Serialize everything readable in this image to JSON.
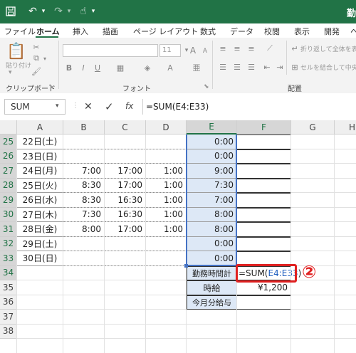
{
  "title_bar": {
    "right_text": "勤",
    "undo_icon": "undo-icon",
    "redo_icon": "redo-icon"
  },
  "tabs": [
    "ファイル",
    "ホーム",
    "挿入",
    "描画",
    "ページ レイアウト",
    "数式",
    "データ",
    "校閲",
    "表示",
    "開発",
    "ヘ"
  ],
  "ribbon": {
    "paste_label": "貼り付け",
    "clipboard_group": "クリップボード",
    "font_group": "フォント",
    "font_size": "11",
    "bold": "B",
    "italic": "I",
    "underline": "U",
    "align_group": "配置",
    "wrap_text": "折り返して全体を表",
    "merge_center": "セルを結合して中央"
  },
  "formula_bar": {
    "name_box": "SUM",
    "cancel": "✕",
    "enter": "✓",
    "fx": "fx",
    "formula": "=SUM(E4:E33)"
  },
  "columns": [
    "A",
    "B",
    "C",
    "D",
    "E",
    "F",
    "G",
    "H"
  ],
  "rows": [
    {
      "n": "25",
      "a": "22日(土)",
      "b": "",
      "c": "",
      "d": "",
      "e": "0:00"
    },
    {
      "n": "26",
      "a": "23日(日)",
      "b": "",
      "c": "",
      "d": "",
      "e": "0:00"
    },
    {
      "n": "27",
      "a": "24日(月)",
      "b": "7:00",
      "c": "17:00",
      "d": "1:00",
      "e": "9:00"
    },
    {
      "n": "28",
      "a": "25日(火)",
      "b": "8:30",
      "c": "17:00",
      "d": "1:00",
      "e": "7:30"
    },
    {
      "n": "29",
      "a": "26日(水)",
      "b": "8:30",
      "c": "16:30",
      "d": "1:00",
      "e": "7:00"
    },
    {
      "n": "30",
      "a": "27日(木)",
      "b": "7:30",
      "c": "16:30",
      "d": "1:00",
      "e": "8:00"
    },
    {
      "n": "31",
      "a": "28日(金)",
      "b": "8:00",
      "c": "17:00",
      "d": "1:00",
      "e": "8:00"
    },
    {
      "n": "32",
      "a": "29日(土)",
      "b": "",
      "c": "",
      "d": "",
      "e": "0:00"
    },
    {
      "n": "33",
      "a": "30日(日)",
      "b": "",
      "c": "",
      "d": "",
      "e": "0:00"
    },
    {
      "n": "34",
      "a": "",
      "b": "",
      "c": "",
      "d": "",
      "e": "勤務時間計"
    },
    {
      "n": "35",
      "a": "",
      "b": "",
      "c": "",
      "d": "",
      "e": "時給"
    },
    {
      "n": "36",
      "a": "",
      "b": "",
      "c": "",
      "d": "",
      "e": "今月分給与"
    },
    {
      "n": "37",
      "a": "",
      "b": "",
      "c": "",
      "d": "",
      "e": ""
    },
    {
      "n": "38",
      "a": "",
      "b": "",
      "c": "",
      "d": "",
      "e": ""
    }
  ],
  "active_cell": {
    "formula_prefix": "=SUM(",
    "range_ref": "E4:E33",
    "formula_suffix": ")"
  },
  "hourly_wage": "¥1,200",
  "callout_number": "②",
  "colors": {
    "excel_green": "#217346",
    "selection": "#dde8f6",
    "ref_blue": "#1f5fbf",
    "callout_red": "#e02020"
  }
}
